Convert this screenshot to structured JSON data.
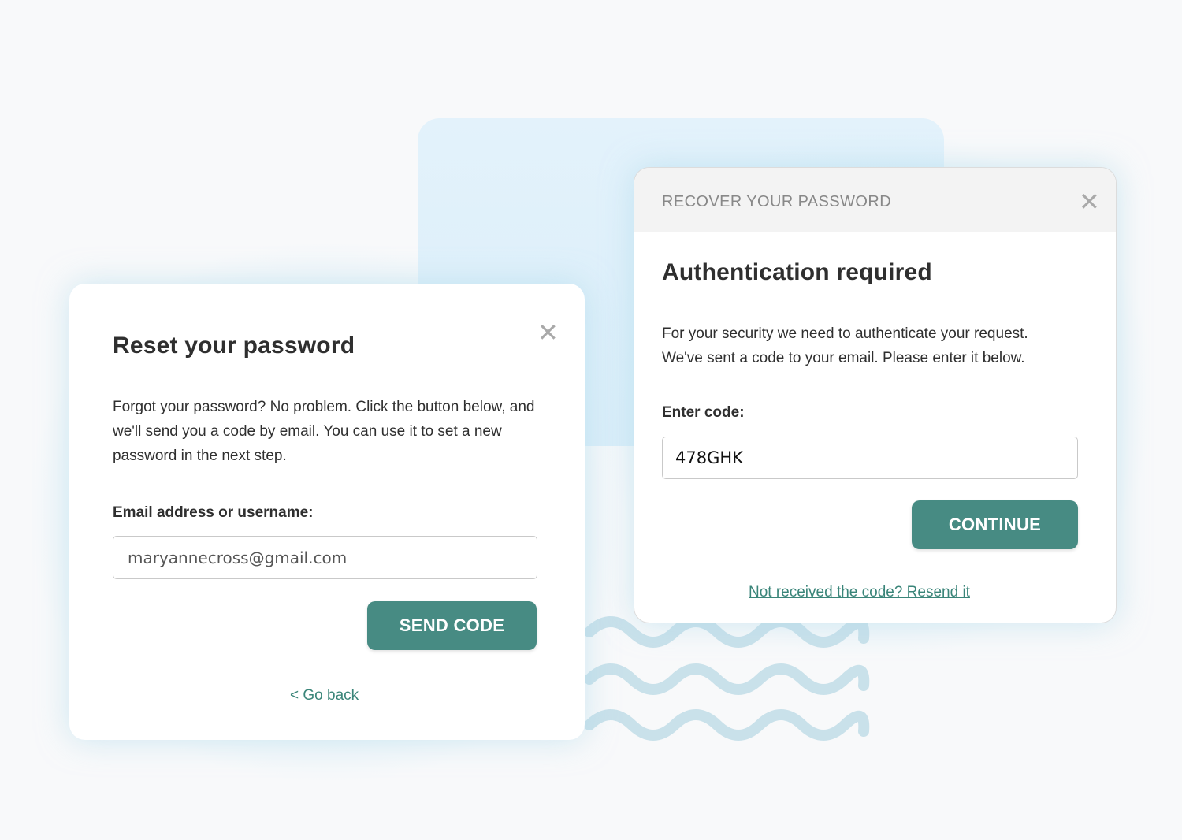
{
  "colors": {
    "accent": "#478b83",
    "link": "#3a8579",
    "text": "#2f2f2f",
    "muted": "#a9a9a9",
    "backdrop": "#e3f2fb"
  },
  "reset_dialog": {
    "title": "Reset your password",
    "close_icon": "close-icon",
    "description": "Forgot your password? No problem. Click the button below, and we'll send you a code by email. You can use it to set a new password in the next step.",
    "field_label": "Email address or username:",
    "field_value": "maryannecross@gmail.com",
    "button_label": "SEND CODE",
    "back_link": "< Go back"
  },
  "recover_dialog": {
    "header_title": "RECOVER YOUR PASSWORD",
    "close_icon": "close-icon",
    "title": "Authentication required",
    "description_line1": "For your security we need to authenticate your request.",
    "description_line2": "We've sent a code to your email. Please enter it below.",
    "field_label": "Enter code:",
    "field_value": "478GHK",
    "button_label": "CONTINUE",
    "resend_link": "Not received the code? Resend it"
  }
}
